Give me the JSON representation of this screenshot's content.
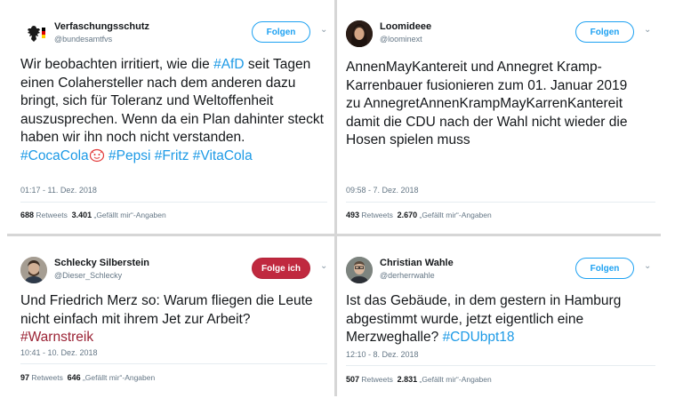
{
  "tweets": [
    {
      "name": "Verfaschungsschutz",
      "handle": "@bundesamtfvs",
      "follow_label": "Folgen",
      "text_lines": [
        "Wir beobachten irritiert, wie die ",
        "#AfD",
        " seit Tagen einen Colahersteller nach dem anderen dazu bringt, sich für Toleranz und Weltoffenheit auszusprechen. Wenn da ein Plan dahinter steckt haben wir ihn noch nicht verstanden."
      ],
      "hashtags": [
        "#CocaCola",
        "#Pepsi",
        "#Fritz",
        "#VitaCola"
      ],
      "timestamp": "01:17 - 11. Dez. 2018",
      "retweets": "688",
      "retweets_label": "Retweets",
      "likes": "3.401",
      "likes_label": "„Gefällt mir“-Angaben"
    },
    {
      "name": "Loomideee",
      "handle": "@loominext",
      "follow_label": "Folgen",
      "text": "AnnenMayKantereit und Annegret Kramp-Karrenbauer fusionieren zum 01. Januar 2019 zu AnnegretAnnenKrampMayKarrenKantereit damit die CDU nach der Wahl nicht wieder die Hosen spielen muss",
      "timestamp": "09:58 - 7. Dez. 2018",
      "retweets": "493",
      "retweets_label": "Retweets",
      "likes": "2.670",
      "likes_label": "„Gefällt mir“-Angaben"
    },
    {
      "name": "Schlecky Silberstein",
      "handle": "@Dieser_Schlecky",
      "follow_label": "Folge ich",
      "text": "Und Friedrich Merz so: Warum fliegen die Leute nicht einfach mit ihrem Jet zur Arbeit?",
      "hashtag": "#Warnstreik",
      "timestamp": "10:41 - 10. Dez. 2018",
      "retweets": "97",
      "retweets_label": "Retweets",
      "likes": "646",
      "likes_label": "„Gefällt mir“-Angaben"
    },
    {
      "name": "Christian Wahle",
      "handle": "@derherrwahle",
      "follow_label": "Folgen",
      "text": "Ist das Gebäude, in dem gestern in Hamburg abgestimmt wurde, jetzt eigentlich eine Merzweghalle?",
      "hashtag": "#CDUbpt18",
      "timestamp": "12:10 - 8. Dez. 2018",
      "retweets": "507",
      "retweets_label": "Retweets",
      "likes": "2.831",
      "likes_label": "„Gefällt mir“-Angaben"
    }
  ],
  "colors": {
    "link_blue": "#1d9ae6",
    "follow_blue": "#1da1f2",
    "following_red": "#c0293f",
    "hashtag_red": "#9b2335"
  },
  "icons": [
    "eagle-icon",
    "cola-emoji-icon",
    "chevron-down-icon"
  ]
}
